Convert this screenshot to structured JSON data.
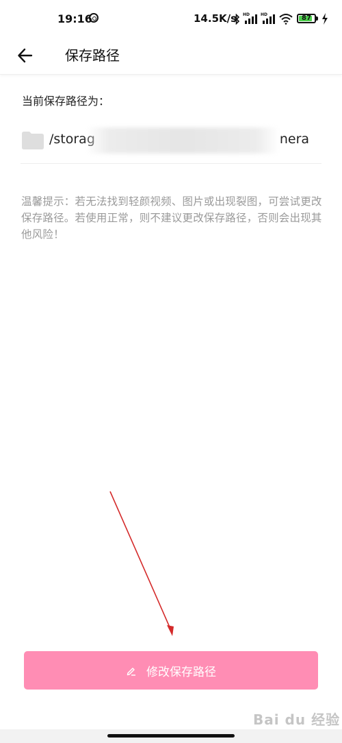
{
  "status_bar": {
    "time": "19:16",
    "network_speed": "14.5K/s",
    "battery_level": "87",
    "battery_fraction": 0.87,
    "icons": [
      "sync-icon",
      "bluetooth-icon",
      "signal-hd-icon",
      "signal-hd-icon",
      "wifi-icon",
      "battery-icon",
      "charging-icon"
    ]
  },
  "header": {
    "title": "保存路径",
    "back_icon": "arrow-left-icon"
  },
  "content": {
    "section_label": "当前保存路径为：",
    "path_start": "/storag",
    "path_end": "nera",
    "folder_icon": "folder-icon",
    "tip": "温馨提示：若无法找到轻颜视频、图片或出现裂图，可尝试更改保存路径。若使用正常，则不建议更改保存路径，否则会出现其他风险！"
  },
  "button": {
    "label": "修改保存路径",
    "icon": "pencil-icon"
  },
  "watermark": "Bai du 经验",
  "colors": {
    "accent": "#ff8db4",
    "annotation": "#d42a2a",
    "tip_text": "#9a9a9a"
  }
}
